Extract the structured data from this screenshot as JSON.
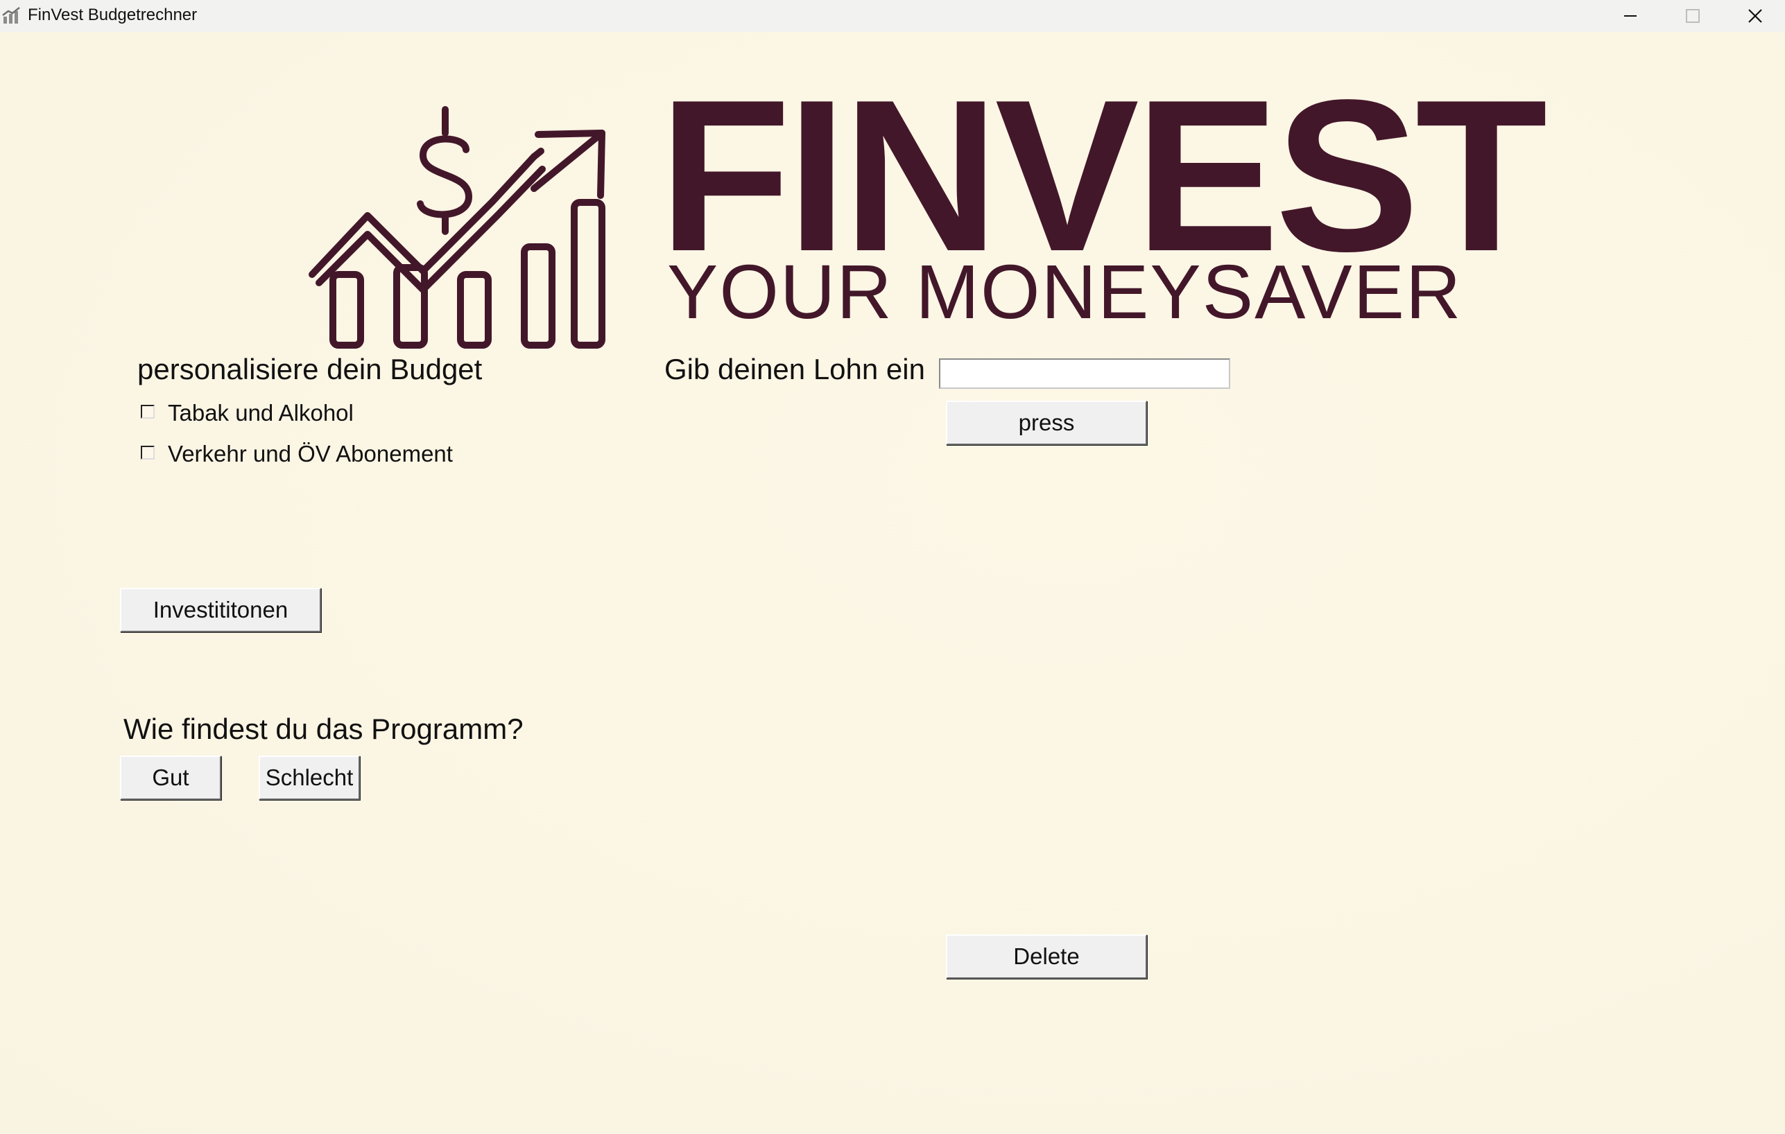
{
  "window": {
    "title": "FinVest Budgetrechner",
    "controls": [
      "minimize",
      "maximize",
      "close"
    ]
  },
  "brand": {
    "title": "FINVEST",
    "subtitle": "YOUR MONEYSAVER",
    "color": "#43172a",
    "logo_icon": "money-growth-chart-icon"
  },
  "budget": {
    "heading": "personalisiere dein Budget",
    "options": [
      {
        "label": "Tabak und Alkohol",
        "checked": false
      },
      {
        "label": "Verkehr und ÖV Abonement",
        "checked": false
      }
    ]
  },
  "salary": {
    "label": "Gib deinen Lohn ein",
    "value": "",
    "submit_label": "press"
  },
  "investments": {
    "button_label": "Investititonen"
  },
  "feedback": {
    "question": "Wie findest du das Programm?",
    "good_label": "Gut",
    "bad_label": "Schlecht"
  },
  "actions": {
    "delete_label": "Delete"
  },
  "colors": {
    "background": "#fcf7e8",
    "button": "#f0f0f0",
    "titlebar": "#f2f2f0"
  }
}
